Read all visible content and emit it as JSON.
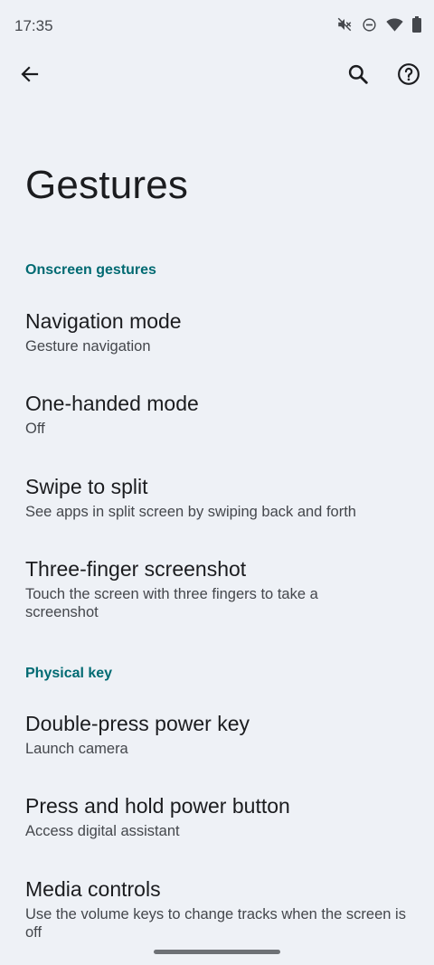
{
  "status_bar": {
    "time": "17:35",
    "icons": [
      "mute-icon",
      "dnd-icon",
      "wifi-icon",
      "battery-icon"
    ]
  },
  "toolbar": {
    "back_icon": "arrow-back-icon",
    "search_icon": "search-icon",
    "help_icon": "help-icon"
  },
  "page": {
    "title": "Gestures"
  },
  "sections": {
    "onscreen": {
      "header": "Onscreen gestures",
      "items": [
        {
          "title": "Navigation mode",
          "summary": "Gesture navigation"
        },
        {
          "title": "One-handed mode",
          "summary": "Off"
        },
        {
          "title": "Swipe to split",
          "summary": "See apps in split screen by swiping back and forth"
        },
        {
          "title": "Three-finger screenshot",
          "summary": "Touch the screen with three fingers to take a screenshot"
        }
      ]
    },
    "physical": {
      "header": "Physical key",
      "items": [
        {
          "title": "Double-press power key",
          "summary": "Launch camera"
        },
        {
          "title": "Press and hold power button",
          "summary": "Access digital assistant"
        },
        {
          "title": "Media controls",
          "summary": "Use the volume keys to change tracks when the screen is off"
        }
      ]
    }
  },
  "colors": {
    "background": "#eef1f6",
    "section_header": "#006a72",
    "title_text": "#1b1c1f",
    "summary_text": "#44474c"
  }
}
